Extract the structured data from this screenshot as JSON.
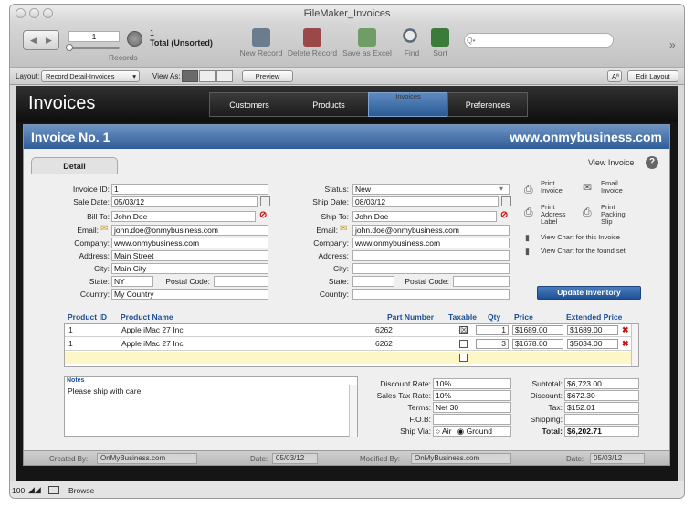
{
  "window": {
    "title": "FileMaker_Invoices"
  },
  "toolbar": {
    "record_number": "1",
    "records_label": "Records",
    "found_count": "1",
    "found_label": "Total (Unsorted)",
    "new_record": "New Record",
    "delete_record": "Delete Record",
    "save_excel": "Save as Excel",
    "find": "Find",
    "sort": "Sort",
    "search_placeholder": "Q•"
  },
  "layoutbar": {
    "layout_label": "Layout:",
    "layout_value": "Record Detail-Invoices",
    "view_as": "View As:",
    "preview": "Preview",
    "font_btn": "Aª",
    "edit_layout": "Edit Layout"
  },
  "app": {
    "title": "Invoices",
    "nav": [
      "Customers",
      "Products",
      "Invoices",
      "Preferences"
    ],
    "active_nav": "Invoices"
  },
  "invoice": {
    "heading": "Invoice No. 1",
    "website": "www.onmybusiness.com",
    "tab": "Detail",
    "view_invoice": "View Invoice",
    "labels": {
      "invoice_id": "Invoice ID:",
      "sale_date": "Sale Date:",
      "bill_to": "Bill To:",
      "email": "Email:",
      "company": "Company:",
      "address": "Address:",
      "city": "City:",
      "state": "State:",
      "postal": "Postal Code:",
      "country": "Country:",
      "status": "Status:",
      "ship_date": "Ship Date:",
      "ship_to": "Ship To:"
    },
    "bill": {
      "invoice_id": "1",
      "sale_date": "05/03/12",
      "bill_to": "John Doe",
      "email": "john.doe@onmybusiness.com",
      "company": "www.onmybusiness.com",
      "address": "Main Street",
      "city": "Main City",
      "state": "NY",
      "postal": "",
      "country": "My Country"
    },
    "ship": {
      "status": "New",
      "ship_date": "08/03/12",
      "ship_to": "John Doe",
      "email": "john.doe@onmybusiness.com",
      "company": "www.onmybusiness.com",
      "address": "",
      "city": "",
      "state": "",
      "postal": "",
      "country": ""
    },
    "actions": {
      "print_invoice": [
        "Print",
        "Invoice"
      ],
      "email_invoice": [
        "Email",
        "Invoice"
      ],
      "print_address": [
        "Print",
        "Address",
        "Label"
      ],
      "print_packing": [
        "Print",
        "Packing",
        "Slip"
      ],
      "chart_invoice": "View Chart for this Invoice",
      "chart_found": "View Chart for the found set",
      "update_inventory": "Update Inventory"
    },
    "line_headers": [
      "Product ID",
      "Product Name",
      "Part Number",
      "Taxable",
      "Qty",
      "Price",
      "Extended Price"
    ],
    "lines": [
      {
        "id": "1",
        "name": "Apple iMac 27 Inc",
        "part": "6262",
        "taxable": "☒",
        "qty": "1",
        "price": "$1689.00",
        "ext": "$1689.00",
        "del": "✖"
      },
      {
        "id": "1",
        "name": "Apple iMac 27 Inc",
        "part": "6262",
        "taxable": "",
        "qty": "3",
        "price": "$1678.00",
        "ext": "$5034.00",
        "del": "✖"
      },
      {
        "id": "",
        "name": "",
        "part": "",
        "taxable": "",
        "qty": "",
        "price": "",
        "ext": "",
        "del": ""
      }
    ],
    "notes_label": "Notes",
    "notes": "Please ship with care",
    "terms_labels": {
      "discount_rate": "Discount Rate:",
      "sales_tax": "Sales Tax Rate:",
      "terms": "Terms:",
      "fob": "F.O.B:",
      "ship_via": "Ship Via:",
      "air": "Air",
      "ground": "Ground"
    },
    "terms": {
      "discount_rate": "10%",
      "sales_tax": "10%",
      "terms": "Net 30",
      "fob": ""
    },
    "totals_labels": {
      "subtotal": "Subtotal:",
      "discount": "Discount:",
      "tax": "Tax:",
      "shipping": "Shipping:",
      "total": "Total:"
    },
    "totals": {
      "subtotal": "$6,723.00",
      "discount": "$672.30",
      "tax": "$152.01",
      "shipping": "",
      "total": "$6,202.71"
    },
    "footer": {
      "created_by_label": "Created By:",
      "created_by": "OnMyBusiness.com",
      "date_label": "Date:",
      "created_date": "05/03/12",
      "modified_by_label": "Modified By:",
      "modified_by": "OnMyBusiness.com",
      "modified_date": "05/03/12"
    }
  },
  "statusbar": {
    "zoom": "100",
    "mode": "Browse"
  }
}
